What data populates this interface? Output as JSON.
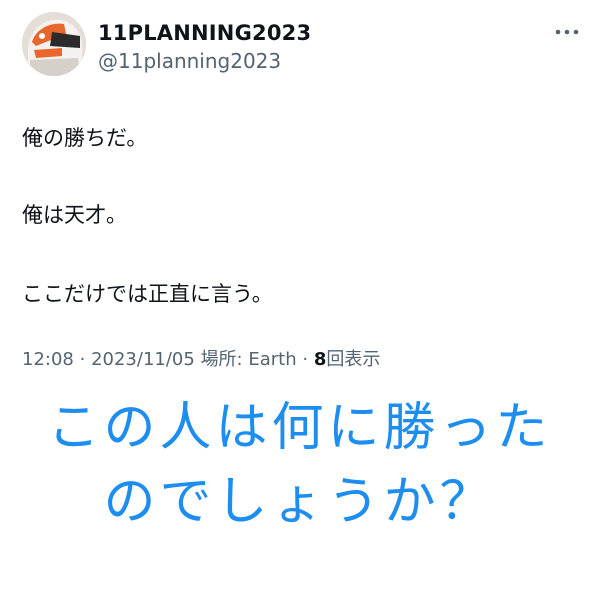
{
  "tweet": {
    "display_name": "11PLANNING2023",
    "handle": "@11planning2023",
    "lines": [
      "俺の勝ちだ。",
      "俺は天才。",
      "ここだけでは正直に言う。"
    ],
    "meta": {
      "time": "12:08",
      "separator": "·",
      "date": "2023/11/05",
      "location_label": "場所:",
      "location": "Earth",
      "views_count": "8",
      "views_label": "回表示"
    }
  },
  "overlay": {
    "line1": "この人は何に勝った",
    "line2": "のでしょうか？"
  },
  "colors": {
    "text": "#0f1419",
    "muted": "#536471",
    "accent": "#1d8ef0"
  },
  "icons": {
    "more": "more-horizontal-icon"
  }
}
